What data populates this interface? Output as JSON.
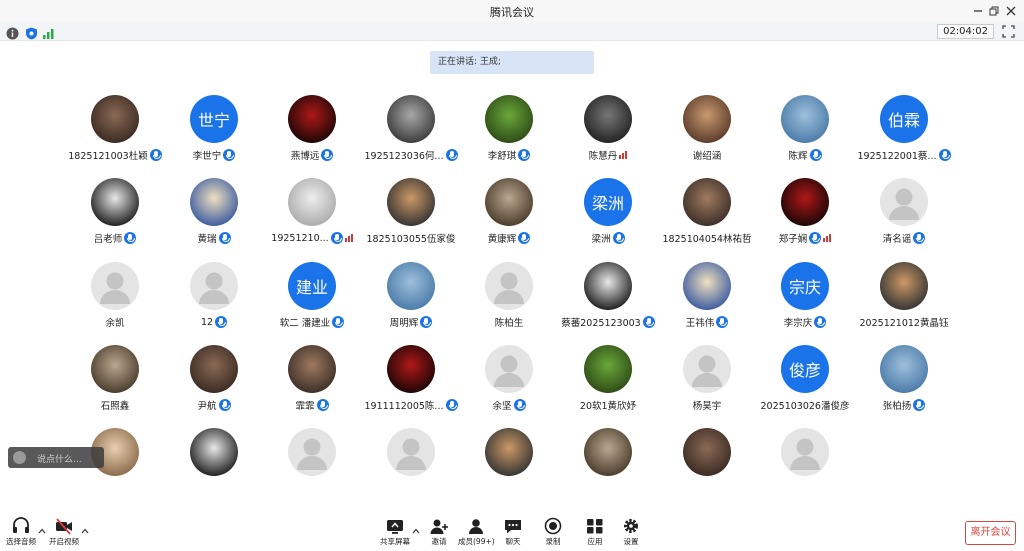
{
  "window": {
    "title": "腾讯会议"
  },
  "status": {
    "timer": "02:04:02"
  },
  "speaking": {
    "label": "正在讲话: 王成;"
  },
  "chat": {
    "placeholder": "说点什么..."
  },
  "colors": {
    "accent": "#1a73e8",
    "leave": "#d8473f",
    "banner": "#d7e5f7"
  },
  "participants": [
    {
      "name": "1825121003杜颖",
      "avatar": "photo",
      "mic": true
    },
    {
      "name": "李世宁",
      "avatar": "initials",
      "initials": "世宁",
      "mic": true
    },
    {
      "name": "燕博远",
      "avatar": "photo",
      "mic": true
    },
    {
      "name": "1925123036何...",
      "avatar": "photo",
      "mic": true
    },
    {
      "name": "李舒琪",
      "avatar": "photo",
      "mic": true
    },
    {
      "name": "陈慧丹",
      "avatar": "photo",
      "mic": false,
      "volume": true
    },
    {
      "name": "谢绍涵",
      "avatar": "photo",
      "mic": false
    },
    {
      "name": "陈辉",
      "avatar": "photo",
      "mic": true
    },
    {
      "name": "1925122001蔡...",
      "avatar": "initials",
      "initials": "伯霖",
      "mic": true
    },
    {
      "name": "吕老师",
      "avatar": "photo",
      "mic": true
    },
    {
      "name": "黄瑞",
      "avatar": "photo",
      "mic": true
    },
    {
      "name": "19251210...",
      "avatar": "photo",
      "mic": true,
      "volume": true
    },
    {
      "name": "1825103055伍家俊",
      "avatar": "photo",
      "mic": false
    },
    {
      "name": "黄康辉",
      "avatar": "photo",
      "mic": true
    },
    {
      "name": "梁洲",
      "avatar": "initials",
      "initials": "梁洲",
      "mic": true
    },
    {
      "name": "1825104054林祐哲",
      "avatar": "photo",
      "mic": false
    },
    {
      "name": "郑子娴",
      "avatar": "photo",
      "mic": true,
      "volume": true
    },
    {
      "name": "清名谣",
      "avatar": "gray",
      "mic": true
    },
    {
      "name": "余凯",
      "avatar": "gray",
      "mic": false
    },
    {
      "name": "12",
      "avatar": "gray",
      "mic": true
    },
    {
      "name": "软二 潘建业",
      "avatar": "initials",
      "initials": "建业",
      "mic": true
    },
    {
      "name": "周明辉",
      "avatar": "photo",
      "mic": true
    },
    {
      "name": "陈柏生",
      "avatar": "gray",
      "mic": false
    },
    {
      "name": "蔡蕃2025123003",
      "avatar": "photo",
      "mic": true
    },
    {
      "name": "王祎伟",
      "avatar": "photo",
      "mic": true
    },
    {
      "name": "李宗庆",
      "avatar": "initials",
      "initials": "宗庆",
      "mic": true
    },
    {
      "name": "2025121012黄晶钰",
      "avatar": "photo",
      "mic": false
    },
    {
      "name": "石照鑫",
      "avatar": "photo",
      "mic": false
    },
    {
      "name": "尹航",
      "avatar": "photo",
      "mic": true
    },
    {
      "name": "霏霏",
      "avatar": "photo",
      "mic": true
    },
    {
      "name": "1911112005陈...",
      "avatar": "photo",
      "mic": true
    },
    {
      "name": "余坚",
      "avatar": "gray",
      "mic": true
    },
    {
      "name": "20软1黄欣妤",
      "avatar": "photo",
      "mic": false
    },
    {
      "name": "杨昊宇",
      "avatar": "gray",
      "mic": false
    },
    {
      "name": "2025103026潘俊彦",
      "avatar": "initials",
      "initials": "俊彦",
      "mic": false
    },
    {
      "name": "张柏扬",
      "avatar": "photo",
      "mic": true
    },
    {
      "name": "",
      "avatar": "photo",
      "mic": false
    },
    {
      "name": "",
      "avatar": "photo",
      "mic": false
    },
    {
      "name": "",
      "avatar": "gray",
      "mic": false
    },
    {
      "name": "",
      "avatar": "gray",
      "mic": false
    },
    {
      "name": "",
      "avatar": "photo",
      "mic": false
    },
    {
      "name": "",
      "avatar": "photo",
      "mic": false
    },
    {
      "name": "",
      "avatar": "photo",
      "mic": false
    },
    {
      "name": "",
      "avatar": "gray",
      "mic": false
    }
  ],
  "toolbar": {
    "audio": "选择音频",
    "video": "开启视频",
    "share": "共享屏幕",
    "invite": "邀请",
    "members": "成员(99+)",
    "chat": "聊天",
    "record": "录制",
    "apps": "应用",
    "settings": "设置",
    "leave": "离开会议"
  }
}
